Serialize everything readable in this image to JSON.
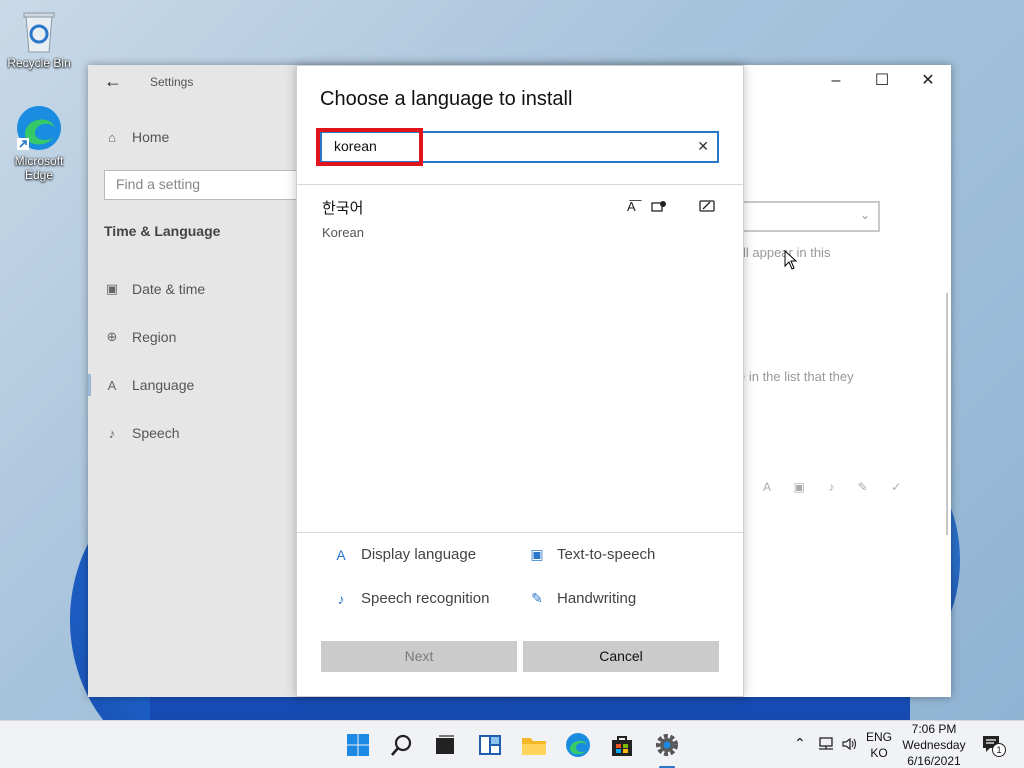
{
  "desktop": {
    "icons": [
      {
        "label": "Recycle Bin",
        "icon": "recycle-bin-icon"
      },
      {
        "label": "Microsoft Edge",
        "icon": "edge-icon"
      }
    ]
  },
  "settings": {
    "app_title": "Settings",
    "nav": {
      "home": "Home",
      "search_placeholder": "Find a setting",
      "section": "Time & Language",
      "items": [
        {
          "label": "Date & time",
          "icon": "calendar-clock-icon"
        },
        {
          "label": "Region",
          "icon": "globe-icon"
        },
        {
          "label": "Language",
          "icon": "language-icon",
          "selected": true
        },
        {
          "label": "Speech",
          "icon": "microphone-icon"
        }
      ]
    },
    "background_text": {
      "line1": "ll appear in this",
      "line2": "e in the list that they"
    }
  },
  "dialog": {
    "title": "Choose a language to install",
    "search_value": "korean",
    "results": [
      {
        "native": "한국어",
        "english": "Korean",
        "features": [
          "display-language-icon",
          "text-to-speech-icon",
          "handwriting-icon"
        ]
      }
    ],
    "legend": [
      {
        "label": "Display language",
        "icon": "display-language-icon"
      },
      {
        "label": "Text-to-speech",
        "icon": "text-to-speech-icon"
      },
      {
        "label": "Speech recognition",
        "icon": "speech-recognition-icon"
      },
      {
        "label": "Handwriting",
        "icon": "handwriting-icon"
      }
    ],
    "buttons": {
      "next": "Next",
      "cancel": "Cancel"
    }
  },
  "taskbar": {
    "tray": {
      "lang_line1": "ENG",
      "lang_line2": "KO",
      "time": "7:06 PM",
      "day": "Wednesday",
      "date": "6/16/2021",
      "notification_count": "1"
    }
  },
  "colors": {
    "accent": "#2a77c9",
    "highlight": "#e3131b"
  }
}
